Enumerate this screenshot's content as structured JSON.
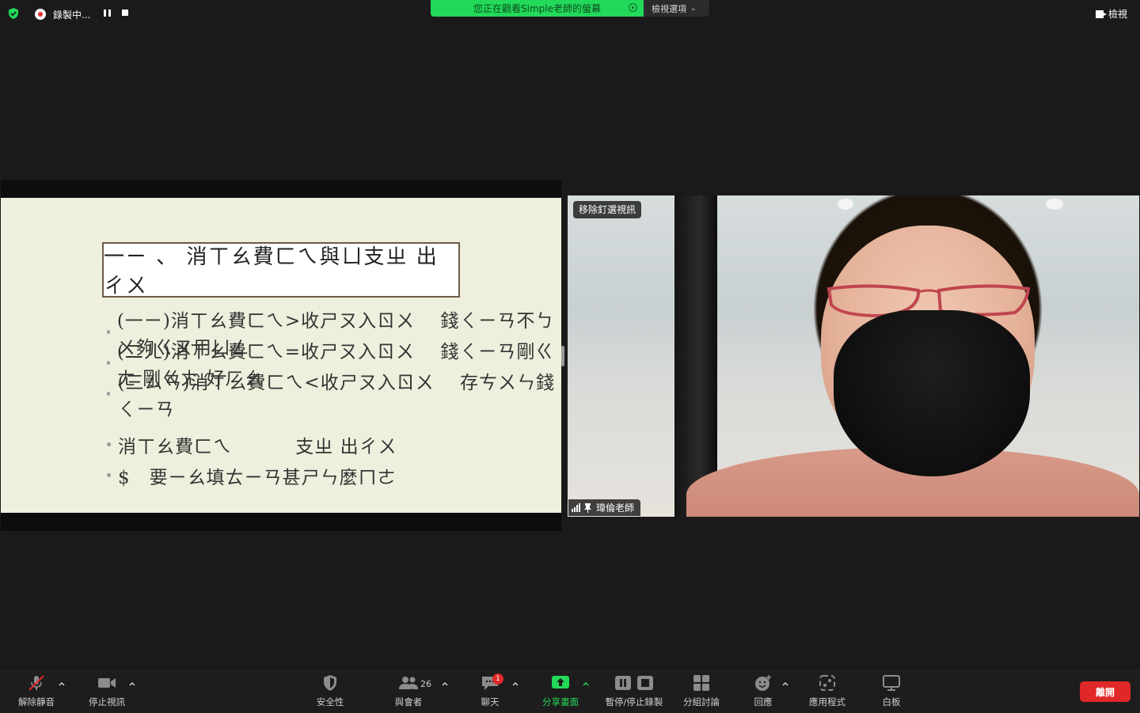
{
  "top_bar": {
    "recording_label": "錄製中...",
    "share_banner_text": "您正在觀看Simple老師的螢幕",
    "view_options_label": "檢視選項",
    "view_label": "檢視"
  },
  "slide": {
    "title": "一ㄧ 、 消ㄒㄠ費ㄈㄟ與ㄩ支ㄓ 出ㄔㄨ",
    "bullets": [
      "(一ㄧ)消ㄒㄠ費ㄈㄟ>收ㄕㄡ入ㄖㄨ　 錢ㄑㄧㄢ不ㄅㄨ夠ㄍㄡ用ㄩㄥ",
      "(二ㄦ)消ㄒㄠ費ㄈㄟ=收ㄕㄡ入ㄖㄨ　 錢ㄑㄧㄢ剛ㄍㄤ 剛ㄍㄤ 好ㄏㄠ",
      "(三ㄙㄢ)消ㄒㄠ費ㄈㄟ<收ㄕㄡ入ㄖㄨ　 存ㄘㄨㄣ錢ㄑㄧㄢ",
      "消ㄒㄠ費ㄈㄟ　　　 支ㄓ 出ㄔㄨ",
      "$　要ㄧㄠ填ㄊㄧㄢ甚ㄕㄣ麼ㄇㄜ"
    ]
  },
  "video": {
    "unpin_label": "移除釘選視訊",
    "participant_name": "瑋倫老師"
  },
  "toolbar": {
    "unmute": "解除靜音",
    "stop_video": "停止視訊",
    "security": "安全性",
    "participants": "與會者",
    "participants_count": "26",
    "chat": "聊天",
    "chat_badge": "1",
    "share_screen": "分享畫面",
    "pause_stop_recording": "暫停/停止錄製",
    "breakout_rooms": "分組討論",
    "reactions": "回應",
    "apps": "應用程式",
    "whiteboard": "白板",
    "leave": "離開"
  },
  "colors": {
    "share_green": "#23d959",
    "leave_red": "#e02828",
    "slide_bg": "#eef0dd"
  }
}
